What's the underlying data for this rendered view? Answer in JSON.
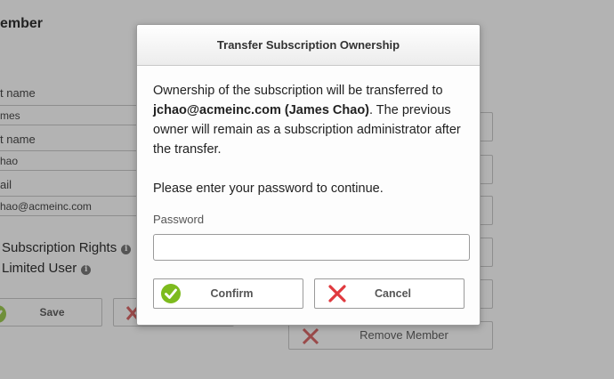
{
  "background": {
    "title": "ember",
    "first_name_label": "t name",
    "first_name_value": "mes",
    "last_name_label": "t name",
    "last_name_value": "hao",
    "email_label": "ail",
    "email_value": "hao@acmeinc.com",
    "subscription_rights_label": "Subscription Rights",
    "limited_user_label": "Limited User",
    "save_label": "Save",
    "remove_member_label": "Remove Member"
  },
  "modal": {
    "title": "Transfer Subscription Ownership",
    "message_prefix": "Ownership of the subscription will be transferred to ",
    "message_user": "jchao@acmeinc.com (James Chao)",
    "message_suffix": ". The previous owner will remain as a subscription administrator after the transfer.",
    "instruction": "Please enter your password to continue.",
    "password_label": "Password",
    "password_value": "",
    "confirm_label": "Confirm",
    "cancel_label": "Cancel"
  },
  "colors": {
    "overlay": "#b3b3b3",
    "confirm_green": "#7dbb1e",
    "cancel_red": "#e0393e"
  }
}
